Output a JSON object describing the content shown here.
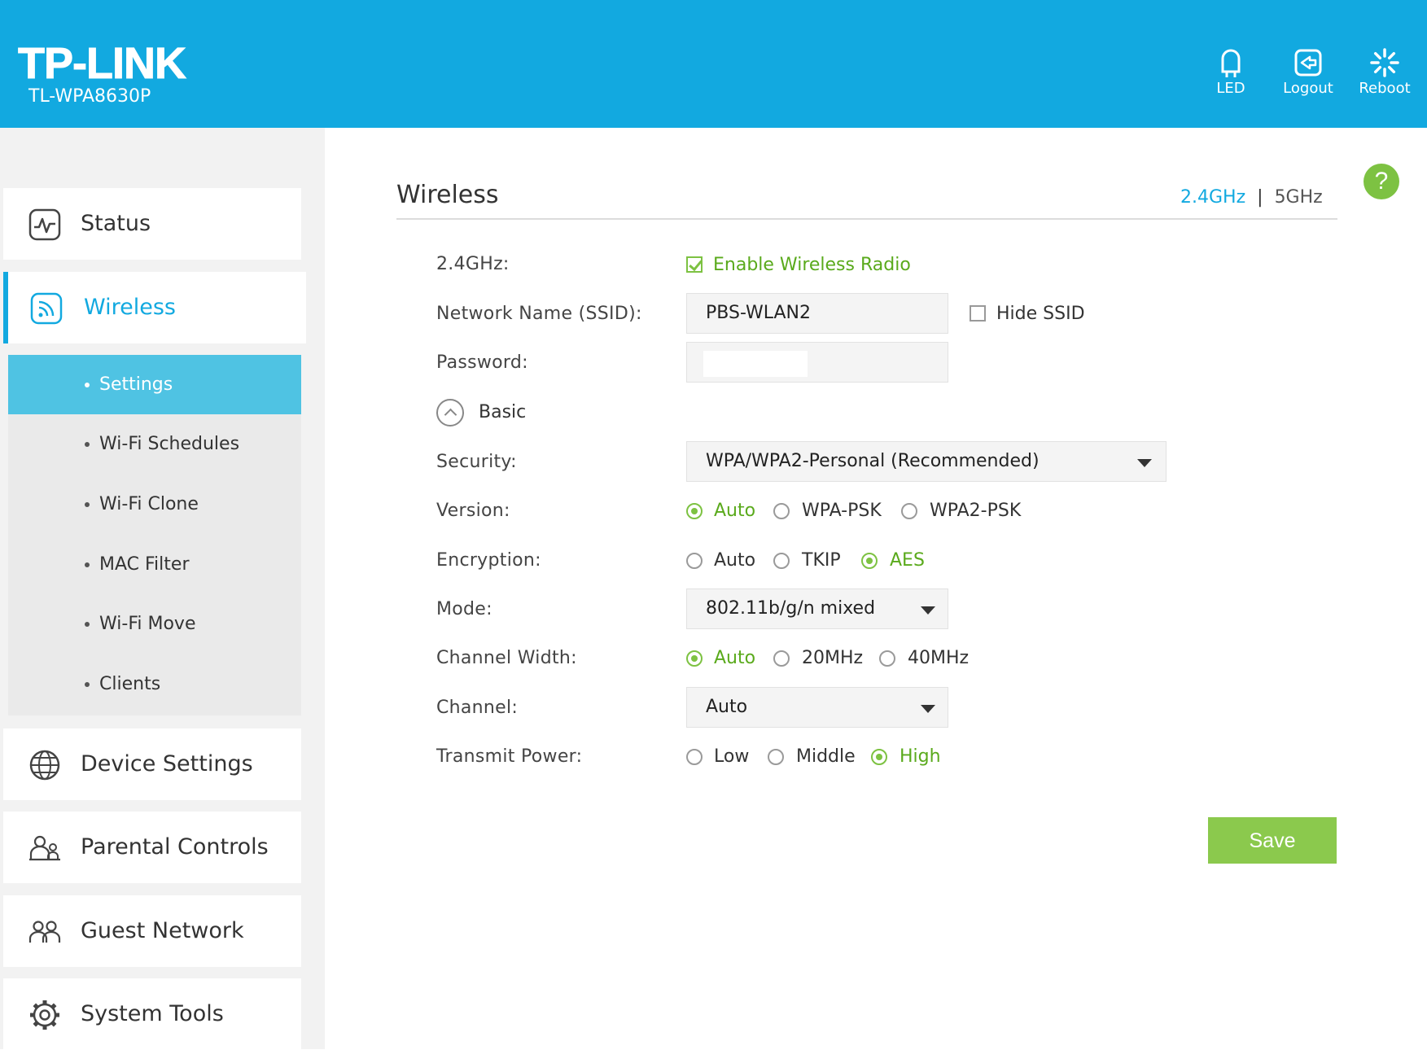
{
  "header": {
    "brand": "TP-LINK",
    "model": "TL-WPA8630P",
    "buttons": [
      {
        "label": "LED",
        "icon": "led-icon"
      },
      {
        "label": "Logout",
        "icon": "logout-icon"
      },
      {
        "label": "Reboot",
        "icon": "reboot-icon"
      }
    ]
  },
  "sidebar": {
    "items": [
      {
        "label": "Status",
        "icon": "status-icon"
      },
      {
        "label": "Wireless",
        "icon": "wireless-icon",
        "active": true
      },
      {
        "label": "Device Settings",
        "icon": "globe-icon"
      },
      {
        "label": "Parental Controls",
        "icon": "parental-controls-icon"
      },
      {
        "label": "Guest Network",
        "icon": "guest-network-icon"
      },
      {
        "label": "System Tools",
        "icon": "gear-icon"
      }
    ],
    "subitems": [
      {
        "label": "Settings",
        "active": true
      },
      {
        "label": "Wi-Fi Schedules"
      },
      {
        "label": "Wi-Fi Clone"
      },
      {
        "label": "MAC Filter"
      },
      {
        "label": "Wi-Fi Move"
      },
      {
        "label": "Clients"
      }
    ]
  },
  "main": {
    "title": "Wireless",
    "bands": {
      "b24": "2.4GHz",
      "separator": "|",
      "b5": "5GHz",
      "active": "2.4GHz"
    },
    "help_icon": "?",
    "form": {
      "band_label": "2.4GHz:",
      "enable_radio_label": "Enable Wireless Radio",
      "enable_radio_checked": true,
      "ssid_label": "Network Name (SSID):",
      "ssid_value": "PBS-WLAN2",
      "hide_ssid_label": "Hide SSID",
      "hide_ssid_checked": false,
      "password_label": "Password:",
      "basic_label": "Basic",
      "security_label": "Security:",
      "security_value": "WPA/WPA2-Personal (Recommended)",
      "version_label": "Version:",
      "version_options": [
        "Auto",
        "WPA-PSK",
        "WPA2-PSK"
      ],
      "version_selected": "Auto",
      "encryption_label": "Encryption:",
      "encryption_options": [
        "Auto",
        "TKIP",
        "AES"
      ],
      "encryption_selected": "AES",
      "mode_label": "Mode:",
      "mode_value": "802.11b/g/n mixed",
      "channel_width_label": "Channel Width:",
      "channel_width_options": [
        "Auto",
        "20MHz",
        "40MHz"
      ],
      "channel_width_selected": "Auto",
      "channel_label": "Channel:",
      "channel_value": "Auto",
      "transmit_power_label": "Transmit Power:",
      "transmit_power_options": [
        "Low",
        "Middle",
        "High"
      ],
      "transmit_power_selected": "High"
    },
    "save_label": "Save"
  },
  "colors": {
    "header_bg": "#12a9e0",
    "accent": "#12a9e0",
    "selected_green": "#7dc242",
    "save_button": "#8bc94d",
    "submenu_active": "#4fc3e3"
  }
}
